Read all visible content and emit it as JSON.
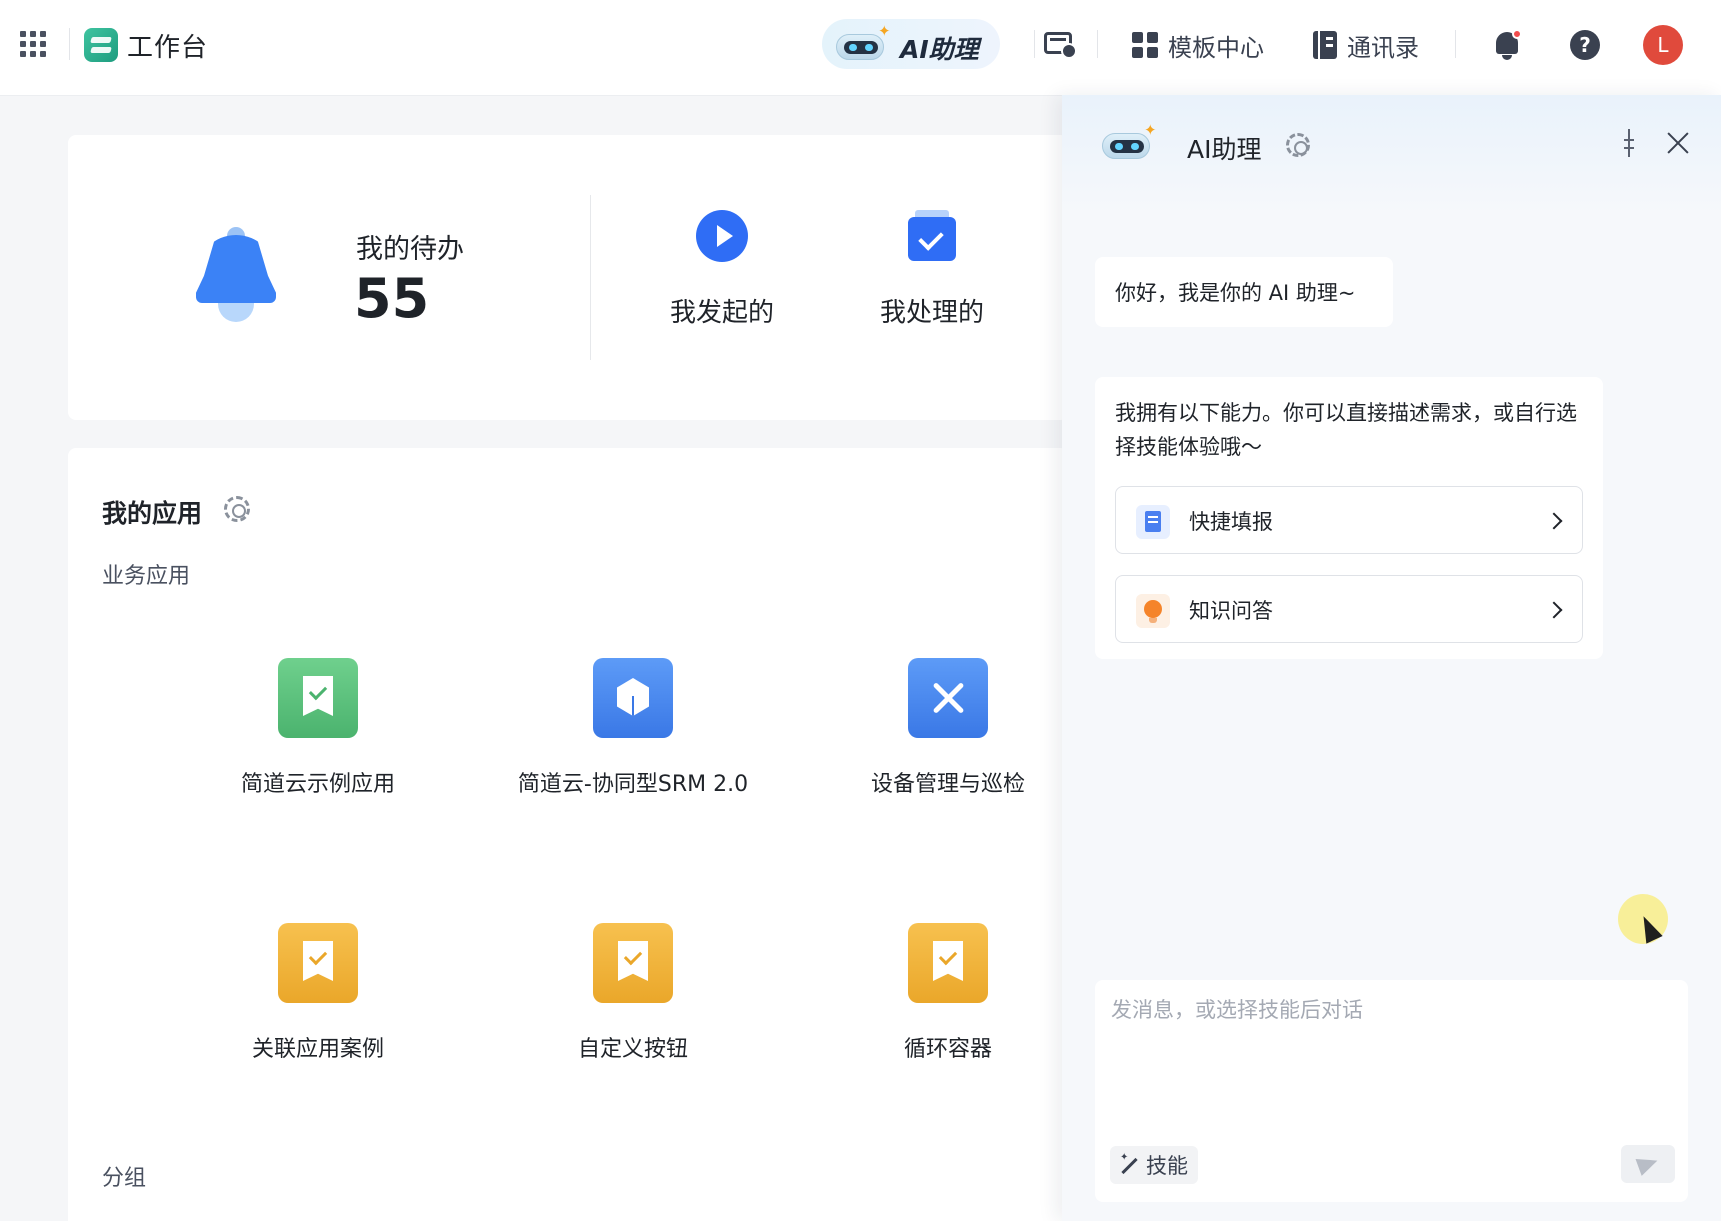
{
  "header": {
    "brand_title": "工作台",
    "ai_label": "AI助理",
    "template_center": "模板中心",
    "contacts": "通讯录",
    "help_symbol": "?",
    "avatar_initial": "L",
    "notification_dot": true
  },
  "todo": {
    "title": "我的待办",
    "count": "55",
    "actions": [
      {
        "label": "我发起的",
        "icon": "play-icon"
      },
      {
        "label": "我处理的",
        "icon": "check-icon"
      }
    ]
  },
  "apps": {
    "title": "我的应用",
    "section": "业务应用",
    "items": [
      {
        "label": "简道云示例应用",
        "icon": "bookmark-check-icon",
        "color": "#4bb36e"
      },
      {
        "label": "简道云-协同型SRM 2.0",
        "icon": "cube-icon",
        "color": "#3a78e6"
      },
      {
        "label": "设备管理与巡检",
        "icon": "tools-icon",
        "color": "#3a78e6"
      },
      {
        "label": "关联应用案例",
        "icon": "bookmark-check-icon",
        "color": "#eaa72a"
      },
      {
        "label": "自定义按钮",
        "icon": "bookmark-check-icon",
        "color": "#eaa72a"
      },
      {
        "label": "循环容器",
        "icon": "bookmark-check-icon",
        "color": "#eaa72a"
      }
    ],
    "group_label": "分组"
  },
  "ai_panel": {
    "title": "AI助理",
    "greeting": "你好，我是你的 AI 助理~",
    "intro": "我拥有以下能力。你可以直接描述需求，或自行选择技能体验哦～",
    "skills": [
      {
        "label": "快捷填报",
        "icon": "form-icon"
      },
      {
        "label": "知识问答",
        "icon": "bulb-icon"
      }
    ],
    "input_placeholder": "发消息，或选择技能后对话",
    "skill_button": "技能"
  },
  "colors": {
    "accent": "#2f6df5",
    "avatar": "#e04a3c",
    "brand": "#1e9c7f"
  }
}
